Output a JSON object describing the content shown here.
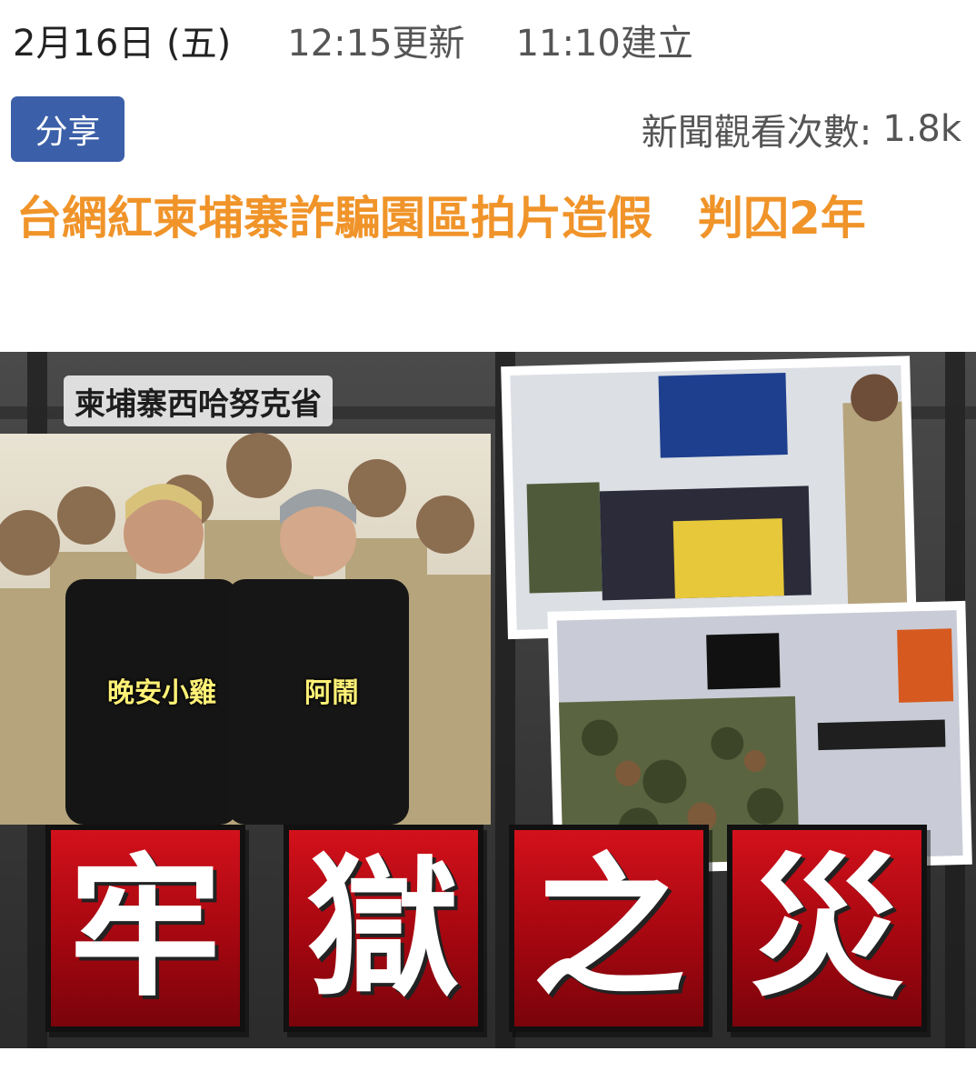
{
  "meta": {
    "date": "2月16日 (五)",
    "updated": "12:15更新",
    "created": "11:10建立"
  },
  "share": {
    "label": "分享"
  },
  "views": {
    "label": "新聞觀看次數:",
    "count": "1.8k"
  },
  "article": {
    "headline": "台網紅柬埔寨詐騙園區拍片造假　判囚2年"
  },
  "hero": {
    "location_caption": "柬埔寨西哈努克省",
    "name_tags": [
      "晚安小雞",
      "阿鬧"
    ],
    "banner_chars": [
      "牢",
      "獄",
      "之",
      "災"
    ]
  },
  "colors": {
    "headline": "#f0942a",
    "share_bg": "#3b5fa8",
    "banner_red": "#c8101a"
  }
}
